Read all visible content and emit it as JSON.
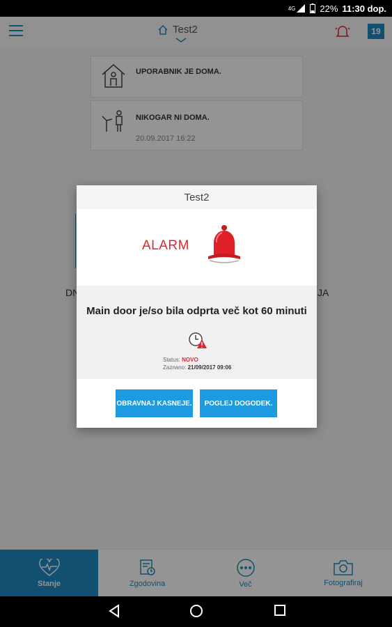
{
  "status_bar": {
    "network": "4G",
    "battery": "22%",
    "time": "11:30 dop."
  },
  "header": {
    "title": "Test2",
    "notification_count": "19"
  },
  "events": [
    {
      "text": "UPORABNIK JE DOMA.",
      "time": ""
    },
    {
      "text": "NIKOGAR NI DOMA.",
      "time": "20.09.2017 16:22"
    }
  ],
  "behind": {
    "left_fragment": "DN",
    "right_fragment": "JA"
  },
  "dialog": {
    "title": "Test2",
    "alarm_label": "ALARM",
    "message": "Main door je/so bila odprta več kot 60 minuti",
    "status_label": "Status:",
    "status_value": "NOVO",
    "detected_label": "Zaznano:",
    "detected_value": "21/09/2017 09:06",
    "btn_later": "OBRAVNAJ KASNEJE.",
    "btn_view": "POGLEJ DOGODEK."
  },
  "bottom_nav": [
    {
      "label": "Stanje",
      "icon": "heart-pulse-icon",
      "active": true
    },
    {
      "label": "Zgodovina",
      "icon": "history-icon",
      "active": false
    },
    {
      "label": "Več",
      "icon": "more-icon",
      "active": false
    },
    {
      "label": "Fotografiraj",
      "icon": "camera-icon",
      "active": false
    }
  ],
  "colors": {
    "accent": "#1e8bc3",
    "button": "#1e9be0",
    "alarm": "#e3262b"
  }
}
